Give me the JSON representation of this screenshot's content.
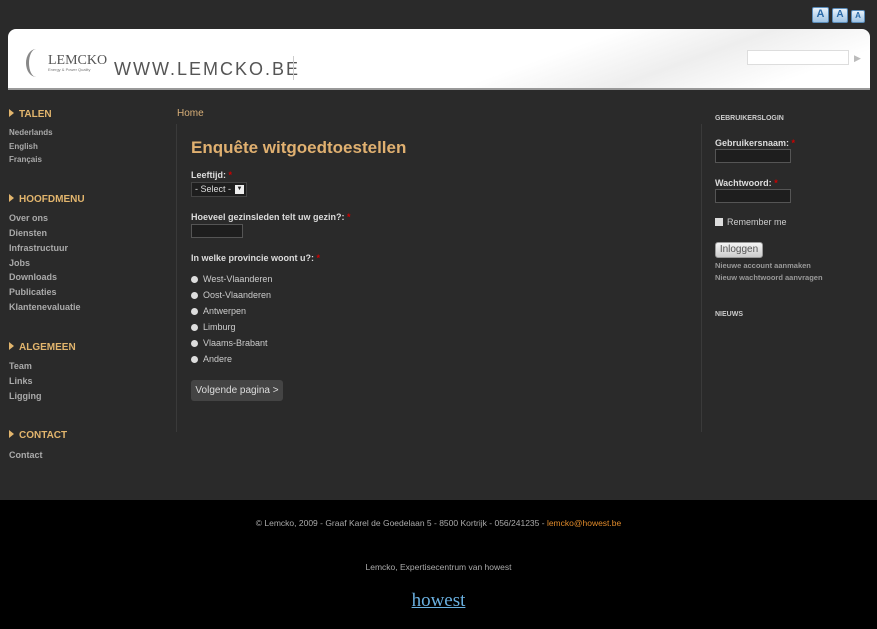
{
  "font_size_buttons": [
    "A",
    "A",
    "A"
  ],
  "header": {
    "logo_name": "LEMCKO",
    "logo_tagline": "Energy & Power Quality",
    "site_url": "WWW.LEMCKO.BE",
    "search_placeholder": ""
  },
  "sidebar": {
    "sections": [
      {
        "title": "TALEN",
        "items": [
          "Nederlands",
          "English",
          "Français"
        ]
      },
      {
        "title": "HOOFDMENU",
        "items": [
          "Over ons",
          "Diensten",
          "Infrastructuur",
          "Jobs",
          "Downloads",
          "Publicaties",
          "Klantenevaluatie"
        ]
      },
      {
        "title": "ALGEMEEN",
        "items": [
          "Team",
          "Links",
          "Ligging"
        ]
      },
      {
        "title": "CONTACT",
        "items": [
          "Contact"
        ]
      }
    ]
  },
  "main": {
    "breadcrumb": "Home",
    "title": "Enquête witgoedtoestellen",
    "age_label": "Leeftijd:",
    "age_value": "- Select -",
    "household_label": "Hoeveel gezinsleden telt uw gezin?:",
    "province_label": "In welke provincie woont u?:",
    "provinces": [
      "West-Vlaanderen",
      "Oost-Vlaanderen",
      "Antwerpen",
      "Limburg",
      "Vlaams-Brabant",
      "Andere"
    ],
    "next_button": "Volgende pagina >",
    "required_mark": "*"
  },
  "login": {
    "title": "GEBRUIKERSLOGIN",
    "username_label": "Gebruikersnaam:",
    "password_label": "Wachtwoord:",
    "remember": "Remember me",
    "submit": "Inloggen",
    "create_account": "Nieuwe account aanmaken",
    "reset_password": "Nieuw wachtwoord aanvragen",
    "news_title": "NIEUWS"
  },
  "footer": {
    "address": "© Lemcko, 2009 - Graaf Karel de Goedelaan 5 - 8500 Kortrijk - 056/241235 - ",
    "email": "lemcko@howest.be",
    "tagline": "Lemcko, Expertisecentrum van howest",
    "partner_logo": "howest"
  },
  "colors": {
    "accent": "#e0b070",
    "background": "#2a2a2a",
    "footer": "#000000",
    "link": "#e08a2a"
  }
}
